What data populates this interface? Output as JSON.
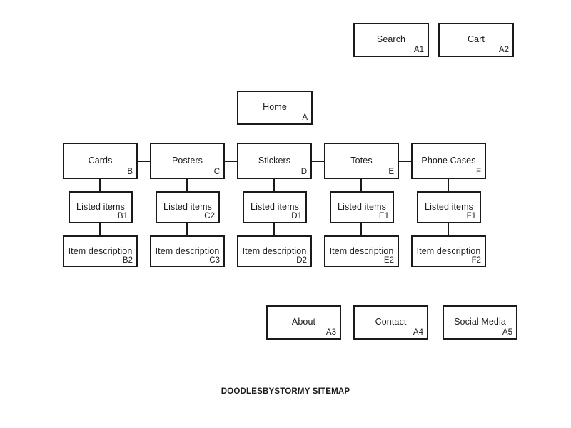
{
  "diagram": {
    "caption": "DOODLESBYSTORMY SITEMAP",
    "line_color": "#1a1a1a",
    "background_color": "#ffffff",
    "utility_nodes": [
      {
        "title": "Search",
        "code": "A1"
      },
      {
        "title": "Cart",
        "code": "A2"
      }
    ],
    "root": {
      "title": "Home",
      "code": "A"
    },
    "categories": [
      {
        "title": "Cards",
        "code": "B"
      },
      {
        "title": "Posters",
        "code": "C"
      },
      {
        "title": "Stickers",
        "code": "D"
      },
      {
        "title": "Totes",
        "code": "E"
      },
      {
        "title": "Phone Cases",
        "code": "F"
      }
    ],
    "listed_items": [
      {
        "title": "Listed items",
        "code": "B1"
      },
      {
        "title": "Listed items",
        "code": "C2"
      },
      {
        "title": "Listed items",
        "code": "D1"
      },
      {
        "title": "Listed items",
        "code": "E1"
      },
      {
        "title": "Listed items",
        "code": "F1"
      }
    ],
    "item_descriptions": [
      {
        "title": "Item description",
        "code": "B2"
      },
      {
        "title": "Item description",
        "code": "C3"
      },
      {
        "title": "Item description",
        "code": "D2"
      },
      {
        "title": "Item description",
        "code": "E2"
      },
      {
        "title": "Item description",
        "code": "F2"
      }
    ],
    "footer_nodes": [
      {
        "title": "About",
        "code": "A3"
      },
      {
        "title": "Contact",
        "code": "A4"
      },
      {
        "title": "Social Media",
        "code": "A5"
      }
    ]
  }
}
